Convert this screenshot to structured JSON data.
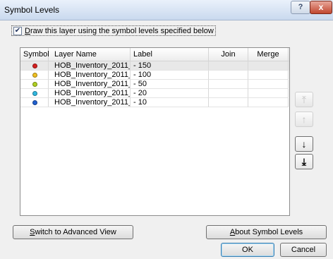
{
  "window": {
    "title": "Symbol Levels",
    "help_label": "?",
    "close_label": "x"
  },
  "draw_checkbox": {
    "checked": true,
    "mnemonic": "D",
    "label_rest": "raw this layer using the symbol levels specified below"
  },
  "table": {
    "columns": [
      "Symbol",
      "Layer Name",
      "Label",
      "Join",
      "Merge"
    ],
    "rows": [
      {
        "symbol_color": "#d62020",
        "layer": "HOB_Inventory_2011_...",
        "label": "- 150"
      },
      {
        "symbol_color": "#f0c020",
        "layer": "HOB_Inventory_2011_...",
        "label": "- 100"
      },
      {
        "symbol_color": "#b0d020",
        "layer": "HOB_Inventory_2011_...",
        "label": "- 50"
      },
      {
        "symbol_color": "#30b8e0",
        "layer": "HOB_Inventory_2011_...",
        "label": "- 20"
      },
      {
        "symbol_color": "#2060d0",
        "layer": "HOB_Inventory_2011_...",
        "label": "- 10"
      }
    ]
  },
  "side_buttons": [
    {
      "icon": "move-to-top-icon",
      "glyph": "⤒",
      "enabled": false
    },
    {
      "icon": "move-up-icon",
      "glyph": "↑",
      "enabled": false
    },
    {
      "icon": "move-down-icon",
      "glyph": "↓",
      "enabled": true
    },
    {
      "icon": "move-to-bottom-icon",
      "glyph": "⤓",
      "enabled": true
    }
  ],
  "buttons": {
    "advanced_mnemonic": "S",
    "advanced_rest": "witch to Advanced View",
    "about_mnemonic": "A",
    "about_rest": "bout Symbol Levels",
    "ok": "OK",
    "cancel": "Cancel"
  }
}
